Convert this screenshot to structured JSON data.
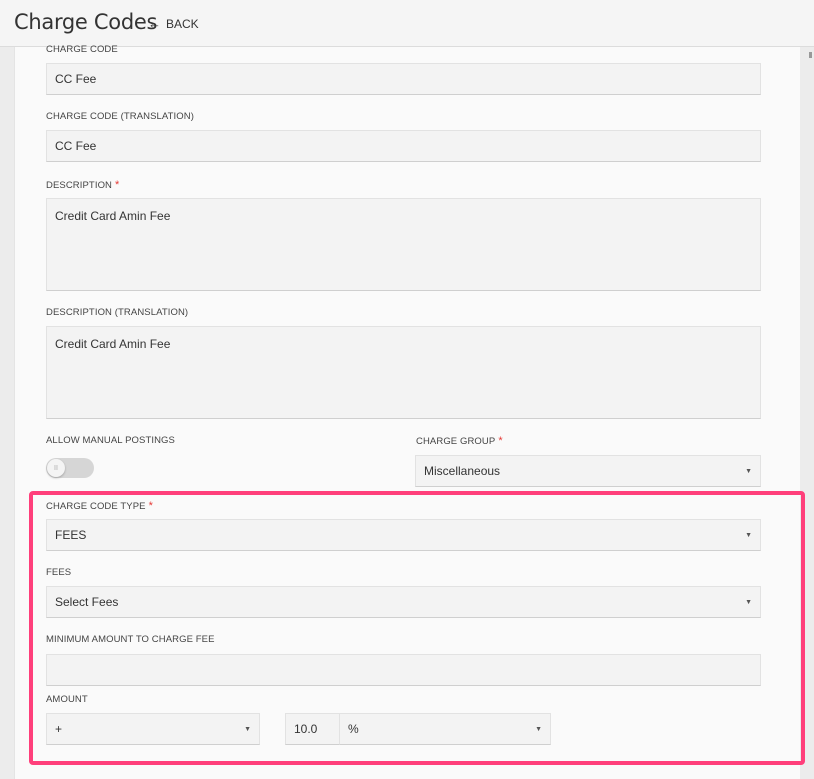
{
  "header": {
    "title": "Charge Codes",
    "back_label": "BACK"
  },
  "form": {
    "charge_code": {
      "label": "CHARGE CODE",
      "value": "CC Fee"
    },
    "charge_code_translation": {
      "label": "CHARGE CODE (TRANSLATION)",
      "value": "CC Fee"
    },
    "description": {
      "label": "DESCRIPTION",
      "required": "*",
      "value": "Credit Card Amin Fee"
    },
    "description_translation": {
      "label": "DESCRIPTION (TRANSLATION)",
      "value": "Credit Card Amin Fee"
    },
    "allow_manual_postings": {
      "label": "ALLOW MANUAL POSTINGS",
      "enabled": false
    },
    "charge_group": {
      "label": "CHARGE GROUP",
      "required": "*",
      "value": "Miscellaneous"
    },
    "charge_code_type": {
      "label": "CHARGE CODE TYPE",
      "required": "*",
      "value": "FEES"
    },
    "fees": {
      "label": "FEES",
      "value": "Select Fees"
    },
    "minimum_amount": {
      "label": "MINIMUM AMOUNT TO CHARGE FEE",
      "value": ""
    },
    "amount": {
      "label": "AMOUNT",
      "sign": "+",
      "value": "10.0",
      "unit": "%"
    }
  },
  "colors": {
    "highlight": "#ff3f7b",
    "required": "#e53935"
  }
}
